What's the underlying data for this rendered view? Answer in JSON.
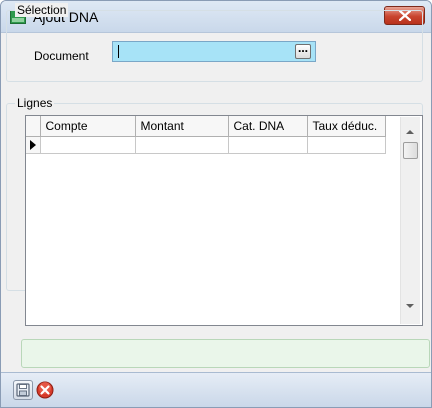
{
  "window": {
    "title": "Ajout DNA"
  },
  "selection": {
    "group_label": "Sélection",
    "document_label": "Document",
    "document_value": ""
  },
  "lignes": {
    "group_label": "Lignes",
    "columns": [
      "Compte",
      "Montant",
      "Cat. DNA",
      "Taux déduc."
    ]
  },
  "status": {
    "text": ""
  },
  "toolbar": {
    "save_icon": "save-icon",
    "cancel_icon": "cancel-icon"
  },
  "colors": {
    "input_bg": "#a7e3f7",
    "status_bg": "#eaf6ea",
    "close_red": "#c9452f"
  }
}
